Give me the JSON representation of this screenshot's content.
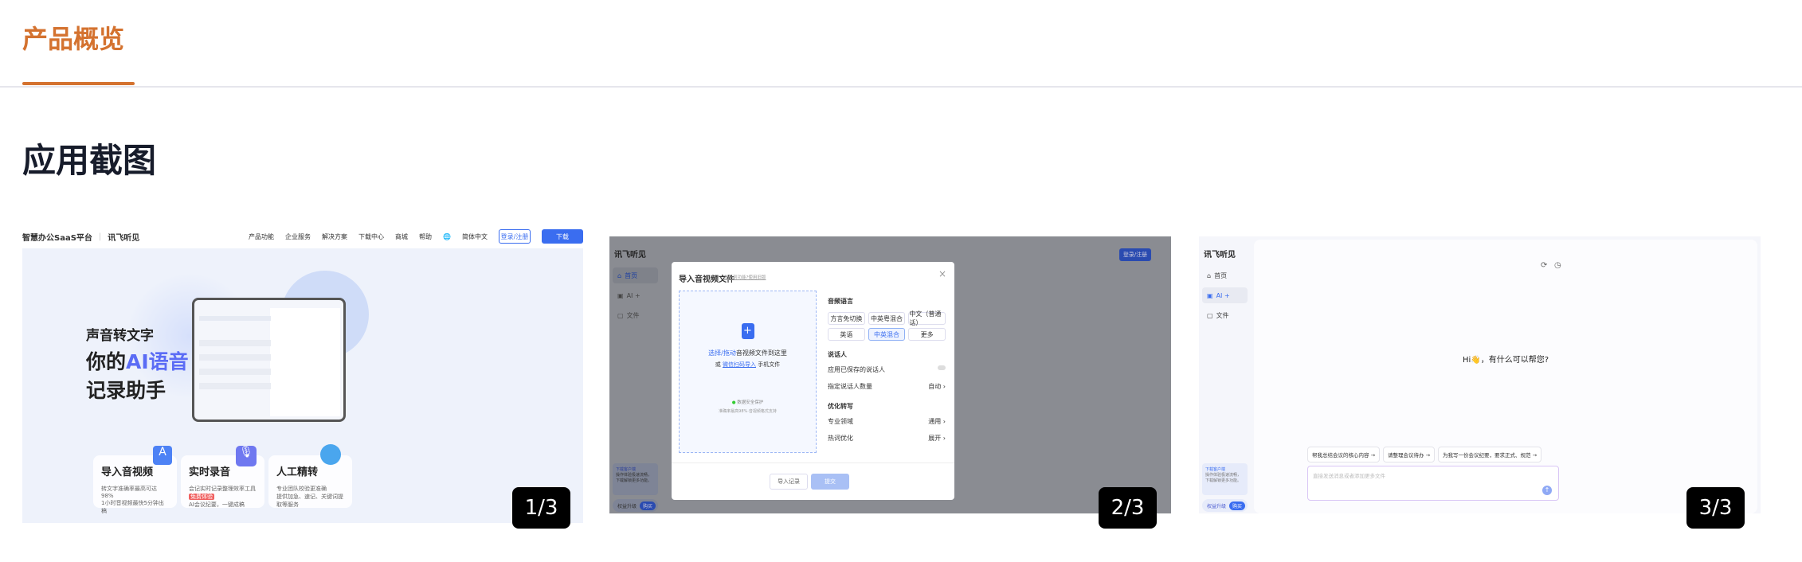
{
  "tabs": [
    {
      "label": "产品概览",
      "active": true
    }
  ],
  "section_title": "应用截图",
  "accent_color": "#D4722F",
  "screenshots": [
    {
      "counter": "1/3",
      "nav": {
        "platform": "智慧办公SaaS平台",
        "logo": "讯飞听见",
        "items": [
          "产品功能",
          "企业服务",
          "解决方案",
          "下载中心",
          "商城",
          "帮助"
        ],
        "language": "简体中文",
        "login": "登录/注册",
        "download": "下载"
      },
      "hero": {
        "line1": "声音转文字",
        "line2_prefix": "你的",
        "line2_highlight": "AI语音",
        "line3": "记录助手"
      },
      "features": [
        {
          "title": "导入音视频",
          "bullets": [
            "转文字准确率最高可达98%",
            "1小时音视频最快5分钟出稿"
          ]
        },
        {
          "title": "实时录音",
          "bullets": [
            "会记实时记录整理效率工具",
            "AI会议纪要，一键成稿"
          ],
          "tag": "免费体验"
        },
        {
          "title": "人工精转",
          "bullets": [
            "专业团队校验更准确",
            "提供加急、速记、关键词提取等服务"
          ]
        }
      ]
    },
    {
      "counter": "2/3",
      "sidebar": {
        "logo": "讯飞听见",
        "items": [
          "首页",
          "AI +",
          "文件"
        ],
        "promo_title": "下载客户端",
        "promo_text": "操作体验极速流畅，下载解锁更多功能。",
        "upgrade": "权益升级",
        "buy": "购买"
      },
      "header_login": "登录/注册",
      "modal": {
        "title": "导入音视频文件",
        "help_link": "找不到功能?使用旧版",
        "drop_highlight": "选择/拖动",
        "drop_text": "音视频文件到这里",
        "or": "或",
        "wechat": "微信扫码导入",
        "phone_file": "手机文件",
        "security": "数据安全保护",
        "formats": "准确率最高98%·音视频格式支持",
        "lang_label": "音频语言",
        "langs": [
          "方言免切换",
          "中英粤混合",
          "中文（普通话）",
          "英语",
          "中英混合",
          "更多"
        ],
        "selected_lang": "中英混合",
        "speaker_label": "说话人",
        "saved_speaker": "应用已保存的说话人",
        "speaker_count": "指定说话人数量",
        "speaker_count_value": "自动",
        "optimize_label": "优化转写",
        "domain": "专业领域",
        "domain_value": "通用",
        "hotword": "热词优化",
        "hotword_value": "展开",
        "history": "导入记录",
        "submit": "提交"
      }
    },
    {
      "counter": "3/3",
      "sidebar": {
        "logo": "讯飞听见",
        "items": [
          "首页",
          "AI +",
          "文件"
        ],
        "active": "AI +",
        "promo_title": "下载客户端",
        "promo_text": "操作体验极速流畅，下载解锁更多功能。",
        "upgrade": "权益升级",
        "buy": "购买"
      },
      "greeting": "Hi👋，有什么可以帮您?",
      "suggestions": [
        "帮我总结会议的核心内容 →",
        "请整理会议待办 →",
        "为我写一份会议纪要，要求正式、规范 →"
      ],
      "input_placeholder": "直接发送消息或者添加更多文件"
    }
  ]
}
